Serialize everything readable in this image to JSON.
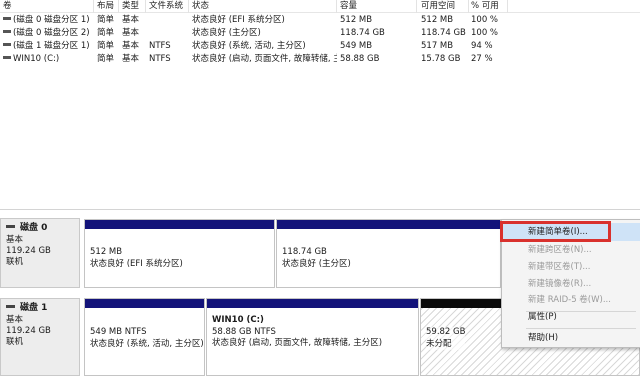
{
  "volume_list": {
    "columns": [
      "卷",
      "布局",
      "类型",
      "文件系统",
      "状态",
      "容量",
      "可用空间",
      "% 可用"
    ],
    "rows": [
      {
        "volume": "(磁盘 0 磁盘分区 1)",
        "layout": "简单",
        "type": "基本",
        "fs": "",
        "status": "状态良好 (EFI 系统分区)",
        "capacity": "512 MB",
        "free": "512 MB",
        "pct": "100 %"
      },
      {
        "volume": "(磁盘 0 磁盘分区 2)",
        "layout": "简单",
        "type": "基本",
        "fs": "",
        "status": "状态良好 (主分区)",
        "capacity": "118.74 GB",
        "free": "118.74 GB",
        "pct": "100 %"
      },
      {
        "volume": "(磁盘 1 磁盘分区 1)",
        "layout": "简单",
        "type": "基本",
        "fs": "NTFS",
        "status": "状态良好 (系统, 活动, 主分区)",
        "capacity": "549 MB",
        "free": "517 MB",
        "pct": "94 %"
      },
      {
        "volume": "WIN10 (C:)",
        "layout": "简单",
        "type": "基本",
        "fs": "NTFS",
        "status": "状态良好 (启动, 页面文件, 故障转储, 主分区)",
        "capacity": "58.88 GB",
        "free": "15.78 GB",
        "pct": "27 %"
      }
    ]
  },
  "disks": [
    {
      "name": "磁盘 0",
      "type": "基本",
      "size": "119.24 GB",
      "state": "联机",
      "partitions": [
        {
          "name": "",
          "line1": "512 MB",
          "line2": "状态良好 (EFI 系统分区)"
        },
        {
          "name": "",
          "line1": "118.74 GB",
          "line2": "状态良好 (主分区)"
        }
      ]
    },
    {
      "name": "磁盘 1",
      "type": "基本",
      "size": "119.24 GB",
      "state": "联机",
      "partitions": [
        {
          "name": "",
          "line1": "549 MB NTFS",
          "line2": "状态良好 (系统, 活动, 主分区)"
        },
        {
          "name": "WIN10  (C:)",
          "line1": "58.88 GB NTFS",
          "line2": "状态良好 (启动, 页面文件, 故障转储, 主分区)"
        },
        {
          "name": "",
          "line1": "59.82 GB",
          "line2": "未分配"
        }
      ]
    }
  ],
  "context_menu": {
    "items": [
      {
        "label": "新建简单卷(I)...",
        "enabled": true,
        "highlighted": true
      },
      {
        "label": "新建跨区卷(N)...",
        "enabled": false
      },
      {
        "label": "新建带区卷(T)...",
        "enabled": false
      },
      {
        "label": "新建镜像卷(R)...",
        "enabled": false
      },
      {
        "label": "新建 RAID-5 卷(W)...",
        "enabled": false
      },
      {
        "label": "属性(P)",
        "enabled": true
      },
      {
        "label": "帮助(H)",
        "enabled": true
      }
    ]
  },
  "colors": {
    "primary_partition_bar": "#13137a",
    "unallocated_bar": "#0a0a0a",
    "menu_highlight": "#cfe3f7",
    "annotation_box": "#d9312d"
  }
}
